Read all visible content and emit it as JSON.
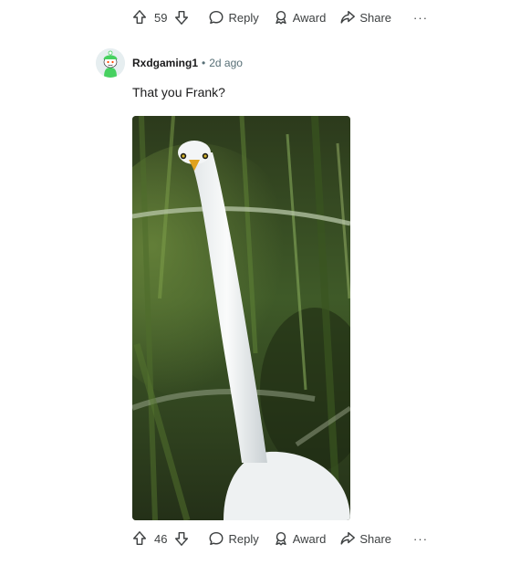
{
  "top_actions": {
    "vote_count": "59",
    "reply_label": "Reply",
    "award_label": "Award",
    "share_label": "Share",
    "more_label": "···"
  },
  "comment": {
    "username": "Rxdgaming1",
    "separator": "•",
    "time": "2d ago",
    "body": "That you Frank?",
    "actions": {
      "vote_count": "46",
      "reply_label": "Reply",
      "award_label": "Award",
      "share_label": "Share",
      "more_label": "···"
    }
  },
  "colors": {
    "text_primary": "#1a1a1b",
    "text_secondary": "#576f76",
    "avatar_green": "#46d160"
  },
  "icons": [
    "upvote-icon",
    "downvote-icon",
    "reply-icon",
    "award-icon",
    "share-icon",
    "more-icon"
  ]
}
